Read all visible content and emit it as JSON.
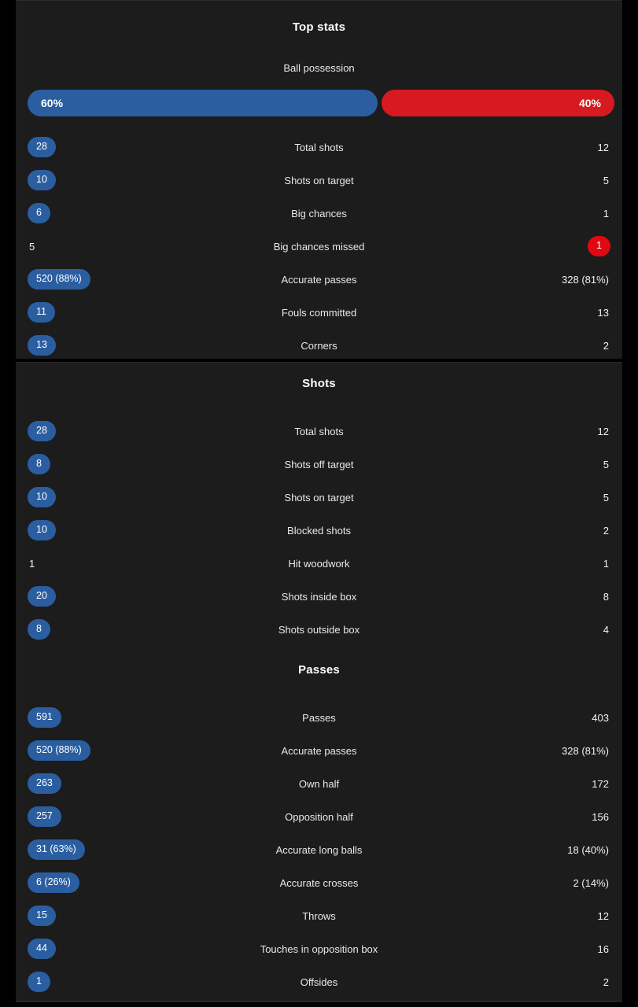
{
  "theme": {
    "page_background": "#000000",
    "card_background": "#1c1c1c",
    "home_color": "#2b5ea0",
    "away_color": "#d71920",
    "away_badge_color": "#e00913",
    "text_color": "#e9e9e9"
  },
  "sections": [
    {
      "title": "Top stats",
      "possession": {
        "label": "Ball possession",
        "home_value": "60%",
        "away_value": "40%",
        "home_percent": 60,
        "away_percent": 40
      },
      "rows": [
        {
          "name": "Total shots",
          "home": "28",
          "away": "12",
          "home_highlight": true,
          "away_highlight": false
        },
        {
          "name": "Shots on target",
          "home": "10",
          "away": "5",
          "home_highlight": true,
          "away_highlight": false
        },
        {
          "name": "Big chances",
          "home": "6",
          "away": "1",
          "home_highlight": true,
          "away_highlight": false
        },
        {
          "name": "Big chances missed",
          "home": "5",
          "away": "1",
          "home_highlight": false,
          "away_highlight": true
        },
        {
          "name": "Accurate passes",
          "home": "520 (88%)",
          "away": "328 (81%)",
          "home_highlight": true,
          "away_highlight": false
        },
        {
          "name": "Fouls committed",
          "home": "11",
          "away": "13",
          "home_highlight": true,
          "away_highlight": false
        },
        {
          "name": "Corners",
          "home": "13",
          "away": "2",
          "home_highlight": true,
          "away_highlight": false
        }
      ]
    },
    {
      "title": "Shots",
      "rows": [
        {
          "name": "Total shots",
          "home": "28",
          "away": "12",
          "home_highlight": true,
          "away_highlight": false
        },
        {
          "name": "Shots off target",
          "home": "8",
          "away": "5",
          "home_highlight": true,
          "away_highlight": false
        },
        {
          "name": "Shots on target",
          "home": "10",
          "away": "5",
          "home_highlight": true,
          "away_highlight": false
        },
        {
          "name": "Blocked shots",
          "home": "10",
          "away": "2",
          "home_highlight": true,
          "away_highlight": false
        },
        {
          "name": "Hit woodwork",
          "home": "1",
          "away": "1",
          "home_highlight": false,
          "away_highlight": false
        },
        {
          "name": "Shots inside box",
          "home": "20",
          "away": "8",
          "home_highlight": true,
          "away_highlight": false
        },
        {
          "name": "Shots outside box",
          "home": "8",
          "away": "4",
          "home_highlight": true,
          "away_highlight": false
        }
      ]
    },
    {
      "title": "Passes",
      "rows": [
        {
          "name": "Passes",
          "home": "591",
          "away": "403",
          "home_highlight": true,
          "away_highlight": false
        },
        {
          "name": "Accurate passes",
          "home": "520 (88%)",
          "away": "328 (81%)",
          "home_highlight": true,
          "away_highlight": false
        },
        {
          "name": "Own half",
          "home": "263",
          "away": "172",
          "home_highlight": true,
          "away_highlight": false
        },
        {
          "name": "Opposition half",
          "home": "257",
          "away": "156",
          "home_highlight": true,
          "away_highlight": false
        },
        {
          "name": "Accurate long balls",
          "home": "31 (63%)",
          "away": "18 (40%)",
          "home_highlight": true,
          "away_highlight": false
        },
        {
          "name": "Accurate crosses",
          "home": "6 (26%)",
          "away": "2 (14%)",
          "home_highlight": true,
          "away_highlight": false
        },
        {
          "name": "Throws",
          "home": "15",
          "away": "12",
          "home_highlight": true,
          "away_highlight": false
        },
        {
          "name": "Touches in opposition box",
          "home": "44",
          "away": "16",
          "home_highlight": true,
          "away_highlight": false
        },
        {
          "name": "Offsides",
          "home": "1",
          "away": "2",
          "home_highlight": true,
          "away_highlight": false
        }
      ]
    }
  ]
}
